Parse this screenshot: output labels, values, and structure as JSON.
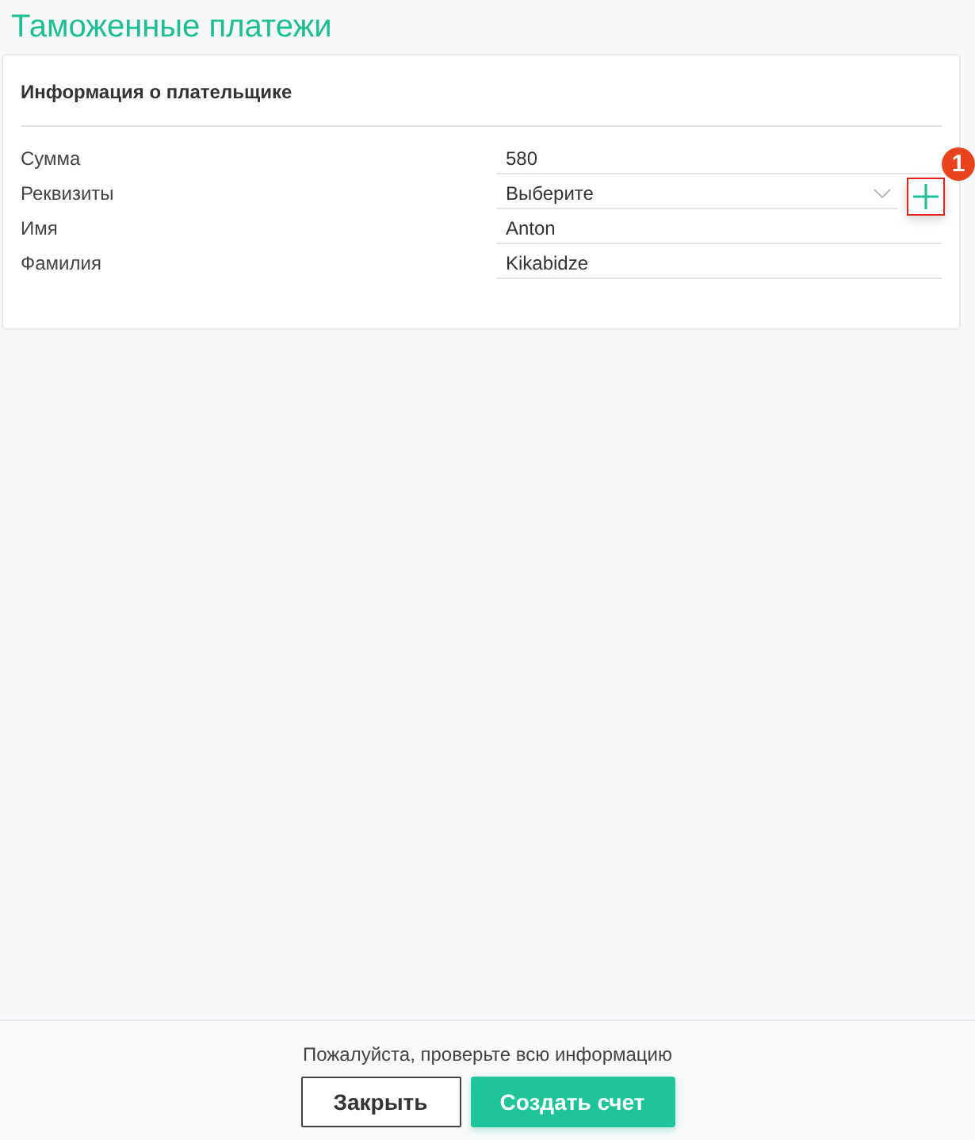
{
  "page": {
    "title": "Таможенные платежи"
  },
  "card": {
    "heading": "Информация о плательщике",
    "fields": [
      {
        "label": "Сумма",
        "kind": "text",
        "value": "580"
      },
      {
        "label": "Реквизиты",
        "kind": "select",
        "value": "Выберите",
        "add_button": {
          "highlighted": true,
          "annotation": "1"
        }
      },
      {
        "label": "Имя",
        "kind": "text",
        "value": "Anton"
      },
      {
        "label": "Фамилия",
        "kind": "text",
        "value": "Kikabidze"
      }
    ]
  },
  "footer": {
    "notice": "Пожалуйста, проверьте всю информацию",
    "buttons": [
      {
        "label": "Закрыть",
        "kind": "secondary"
      },
      {
        "label": "Создать счет",
        "kind": "primary"
      }
    ]
  }
}
